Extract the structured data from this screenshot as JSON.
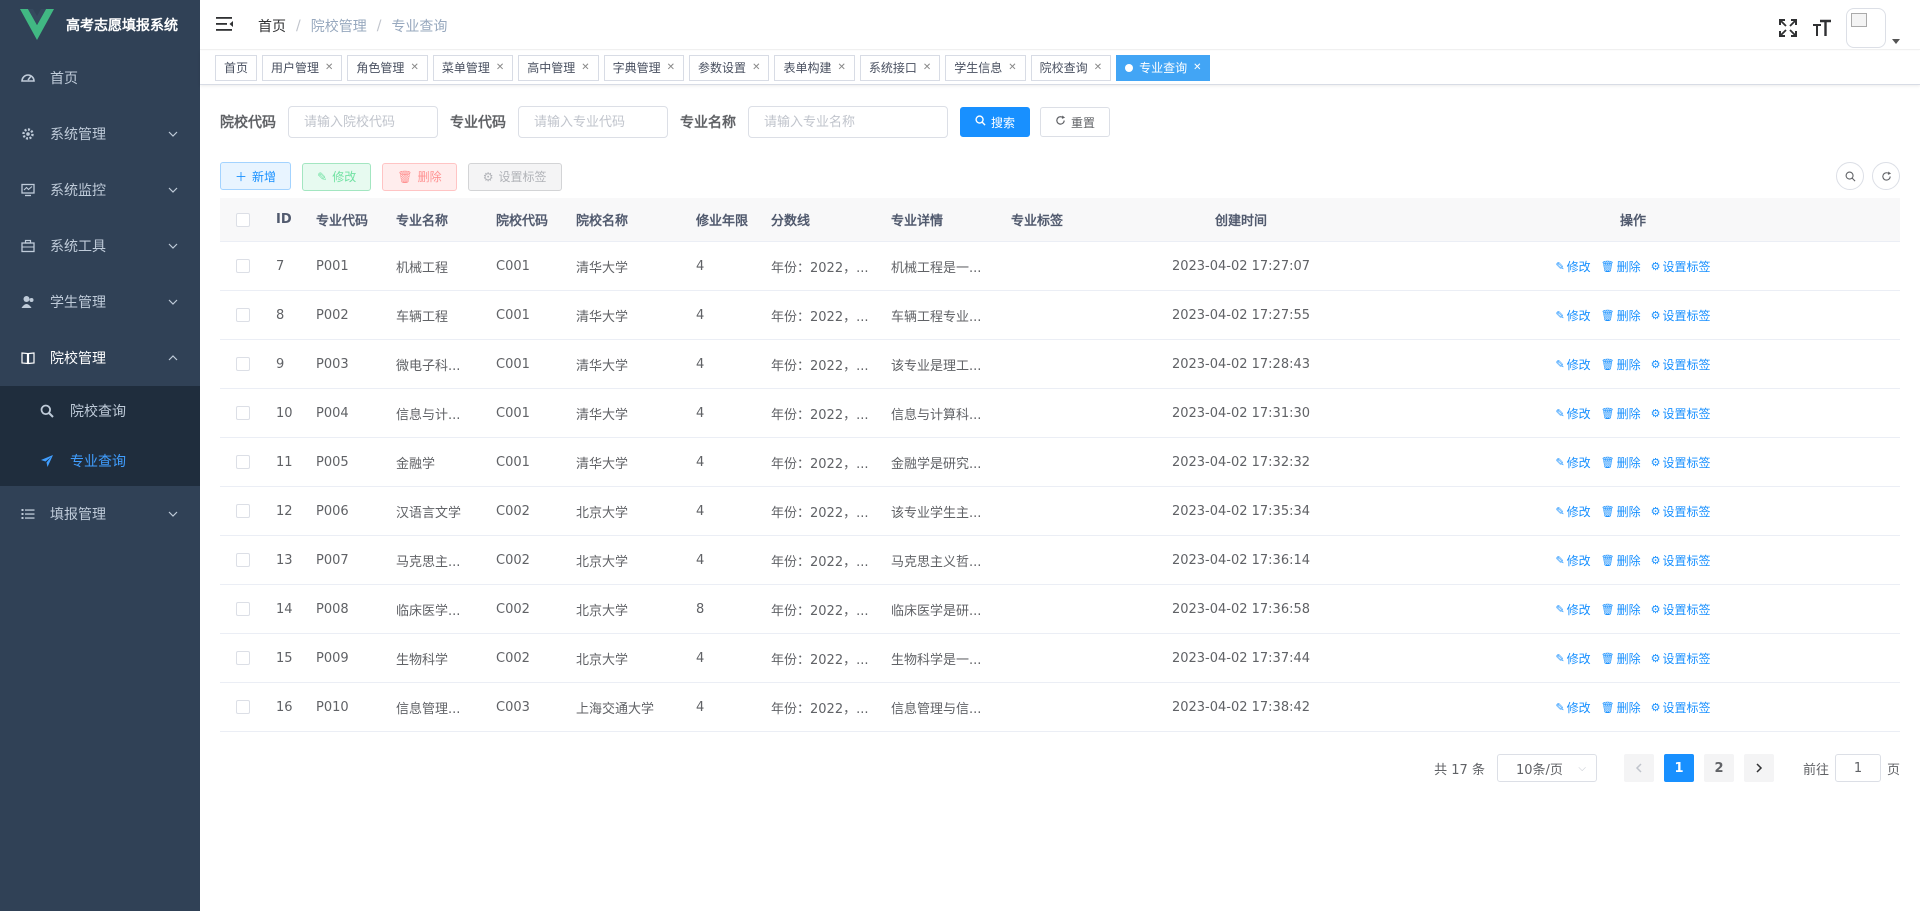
{
  "app": {
    "title": "高考志愿填报系统"
  },
  "sidebar": {
    "items": [
      {
        "label": "首页",
        "icon": "dashboard-icon"
      },
      {
        "label": "系统管理",
        "icon": "gear-icon"
      },
      {
        "label": "系统监控",
        "icon": "monitor-icon"
      },
      {
        "label": "系统工具",
        "icon": "toolbox-icon"
      },
      {
        "label": "学生管理",
        "icon": "user-icon"
      },
      {
        "label": "院校管理",
        "icon": "book-icon"
      },
      {
        "label": "填报管理",
        "icon": "list-icon"
      }
    ],
    "sub": [
      {
        "label": "院校查询",
        "icon": "search-icon"
      },
      {
        "label": "专业查询",
        "icon": "send-icon"
      }
    ]
  },
  "breadcrumb": [
    "首页",
    "院校管理",
    "专业查询"
  ],
  "tags": [
    "首页",
    "用户管理",
    "角色管理",
    "菜单管理",
    "高中管理",
    "字典管理",
    "参数设置",
    "表单构建",
    "系统接口",
    "学生信息",
    "院校查询",
    "专业查询"
  ],
  "search": {
    "school_code_label": "院校代码",
    "school_code_placeholder": "请输入院校代码",
    "major_code_label": "专业代码",
    "major_code_placeholder": "请输入专业代码",
    "major_name_label": "专业名称",
    "major_name_placeholder": "请输入专业名称",
    "search_label": "搜索",
    "reset_label": "重置"
  },
  "toolbar": {
    "add": "新增",
    "edit": "修改",
    "delete": "删除",
    "set_tag": "设置标签"
  },
  "table": {
    "headers": {
      "id": "ID",
      "code": "专业代码",
      "name": "专业名称",
      "scode": "院校代码",
      "sname": "院校名称",
      "years": "修业年限",
      "score": "分数线",
      "detail": "专业详情",
      "tag": "专业标签",
      "time": "创建时间",
      "ops": "操作"
    },
    "ops": {
      "edit": "修改",
      "delete": "删除",
      "set_tag": "设置标签"
    },
    "rows": [
      {
        "id": "7",
        "code": "P001",
        "name": "机械工程",
        "scode": "C001",
        "sname": "清华大学",
        "years": "4",
        "score": "年份：2022，...",
        "detail": "机械工程是一...",
        "tag": "",
        "time": "2023-04-02 17:27:07"
      },
      {
        "id": "8",
        "code": "P002",
        "name": "车辆工程",
        "scode": "C001",
        "sname": "清华大学",
        "years": "4",
        "score": "年份：2022，...",
        "detail": "车辆工程专业...",
        "tag": "",
        "time": "2023-04-02 17:27:55"
      },
      {
        "id": "9",
        "code": "P003",
        "name": "微电子科...",
        "scode": "C001",
        "sname": "清华大学",
        "years": "4",
        "score": "年份：2022，...",
        "detail": "该专业是理工...",
        "tag": "",
        "time": "2023-04-02 17:28:43"
      },
      {
        "id": "10",
        "code": "P004",
        "name": "信息与计...",
        "scode": "C001",
        "sname": "清华大学",
        "years": "4",
        "score": "年份：2022，...",
        "detail": "信息与计算科...",
        "tag": "",
        "time": "2023-04-02 17:31:30"
      },
      {
        "id": "11",
        "code": "P005",
        "name": "金融学",
        "scode": "C001",
        "sname": "清华大学",
        "years": "4",
        "score": "年份：2022，...",
        "detail": "金融学是研究...",
        "tag": "",
        "time": "2023-04-02 17:32:32"
      },
      {
        "id": "12",
        "code": "P006",
        "name": "汉语言文学",
        "scode": "C002",
        "sname": "北京大学",
        "years": "4",
        "score": "年份：2022，...",
        "detail": "该专业学生主...",
        "tag": "",
        "time": "2023-04-02 17:35:34"
      },
      {
        "id": "13",
        "code": "P007",
        "name": "马克思主...",
        "scode": "C002",
        "sname": "北京大学",
        "years": "4",
        "score": "年份：2022，...",
        "detail": "马克思主义哲...",
        "tag": "",
        "time": "2023-04-02 17:36:14"
      },
      {
        "id": "14",
        "code": "P008",
        "name": "临床医学...",
        "scode": "C002",
        "sname": "北京大学",
        "years": "8",
        "score": "年份：2022，...",
        "detail": "临床医学是研...",
        "tag": "",
        "time": "2023-04-02 17:36:58"
      },
      {
        "id": "15",
        "code": "P009",
        "name": "生物科学",
        "scode": "C002",
        "sname": "北京大学",
        "years": "4",
        "score": "年份：2022，...",
        "detail": "生物科学是一...",
        "tag": "",
        "time": "2023-04-02 17:37:44"
      },
      {
        "id": "16",
        "code": "P010",
        "name": "信息管理...",
        "scode": "C003",
        "sname": "上海交通大学",
        "years": "4",
        "score": "年份：2022，...",
        "detail": "信息管理与信...",
        "tag": "",
        "time": "2023-04-02 17:38:42"
      }
    ]
  },
  "pagination": {
    "total": "共 17 条",
    "page_size": "10条/页",
    "pages": [
      "1",
      "2"
    ],
    "goto_prefix": "前往",
    "goto_value": "1",
    "goto_suffix": "页"
  },
  "colors": {
    "sidebar_bg": "#304156",
    "primary": "#1890ff",
    "active_tag": "#42a5f5",
    "logo_green": "#41b883"
  }
}
